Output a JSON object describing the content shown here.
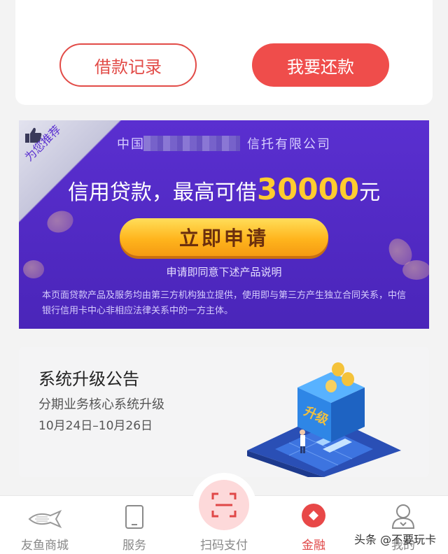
{
  "actions": {
    "loan_records": "借款记录",
    "repay": "我要还款"
  },
  "banner": {
    "corner_label": "为您推荐",
    "company_prefix": "中国",
    "company_suffix": "信托有限公司",
    "headline_prefix": "信用贷款，最高可借",
    "headline_amount": "30000",
    "headline_unit": "元",
    "apply_button": "立即申请",
    "agree_text": "申请即同意下述产品说明",
    "disclaimer": "本页面贷款产品及服务均由第三方机构独立提供，使用即与第三方产生独立合同关系，中信银行信用卡中心非相应法律关系中的一方主体。"
  },
  "notice": {
    "title": "系统升级公告",
    "subtitle": "分期业务核心系统升级",
    "date_range": "10月24日–10月26日",
    "illustration_text": "升级"
  },
  "nav": {
    "items": [
      {
        "label": "友鱼商城",
        "icon": "fish-icon",
        "active": false
      },
      {
        "label": "服务",
        "icon": "tablet-icon",
        "active": false
      },
      {
        "label": "扫码支付",
        "icon": "scan-icon",
        "active": false
      },
      {
        "label": "金融",
        "icon": "finance-diamond-icon",
        "active": true
      },
      {
        "label": "我的",
        "icon": "user-icon",
        "active": false
      }
    ]
  },
  "watermark": "头条 @不要玩卡",
  "colors": {
    "accent_red": "#ef4d4b",
    "banner_purple": "#5a2fd0",
    "amount_yellow": "#ffcc2f"
  }
}
